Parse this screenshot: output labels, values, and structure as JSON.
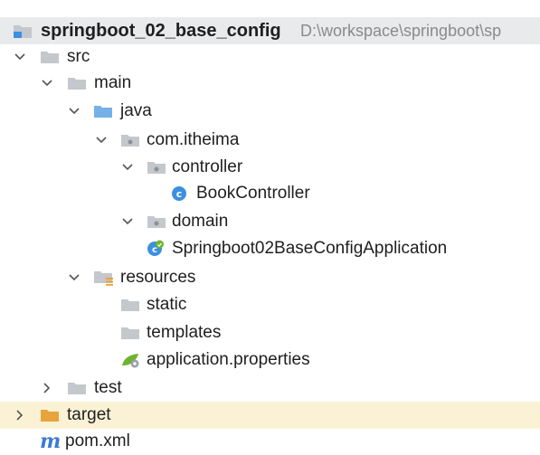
{
  "project": {
    "name": "springboot_02_base_config",
    "path": "D:\\workspace\\springboot\\sp"
  },
  "tree": {
    "src": "src",
    "main": "main",
    "java": "java",
    "package": "com.itheima",
    "controller": "controller",
    "book_controller": "BookController",
    "domain": "domain",
    "application_class": "Springboot02BaseConfigApplication",
    "resources": "resources",
    "static": "static",
    "templates": "templates",
    "properties": "application.properties",
    "test": "test",
    "target": "target",
    "pom": "pom.xml"
  },
  "icons": {
    "folder": "folder-icon",
    "source_folder": "source-root-folder-icon",
    "package": "package-folder-icon",
    "resources": "resources-root-folder-icon",
    "excluded": "excluded-folder-icon",
    "class": "class-c-icon",
    "spring_app": "spring-boot-class-icon",
    "properties": "spring-properties-icon",
    "maven": "maven-m-icon"
  },
  "colors": {
    "folder_gray": "#c4c7cc",
    "folder_blue": "#75b1e7",
    "folder_orange": "#e8a33a",
    "class_blue": "#3d8fe0",
    "spring_green": "#6cb52d",
    "header_bg": "#e9eaec",
    "target_bg": "#fbf2d6"
  }
}
